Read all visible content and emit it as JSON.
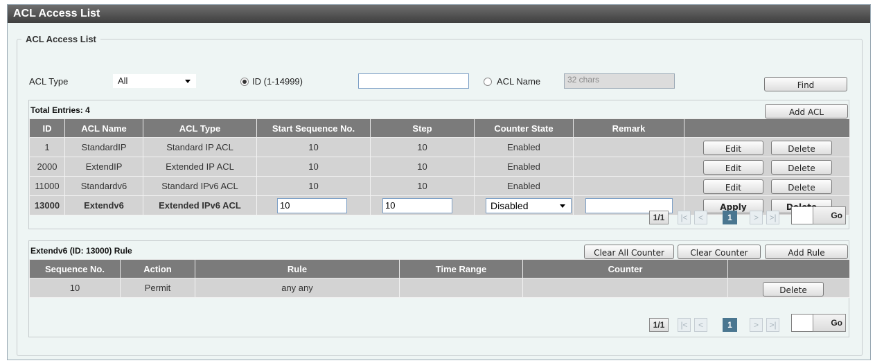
{
  "page": {
    "title": "ACL Access List"
  },
  "filter": {
    "legend": "ACL Access List",
    "acl_type_label": "ACL Type",
    "acl_type_value": "All",
    "radio_id_label": "ID (1-14999)",
    "id_value": "",
    "radio_name_label": "ACL Name",
    "name_placeholder": "32 chars",
    "find_label": "Find"
  },
  "acl_table": {
    "total_label": "Total Entries: 4",
    "add_label": "Add ACL",
    "columns": [
      "ID",
      "ACL Name",
      "ACL Type",
      "Start Sequence No.",
      "Step",
      "Counter State",
      "Remark",
      ""
    ],
    "rows": [
      {
        "id": "1",
        "name": "StandardIP",
        "type": "Standard IP ACL",
        "start": "10",
        "step": "10",
        "counter": "Enabled",
        "remark": "",
        "edit": "Edit",
        "delete": "Delete"
      },
      {
        "id": "2000",
        "name": "ExtendIP",
        "type": "Extended IP ACL",
        "start": "10",
        "step": "10",
        "counter": "Enabled",
        "remark": "",
        "edit": "Edit",
        "delete": "Delete"
      },
      {
        "id": "11000",
        "name": "Standardv6",
        "type": "Standard IPv6 ACL",
        "start": "10",
        "step": "10",
        "counter": "Enabled",
        "remark": "",
        "edit": "Edit",
        "delete": "Delete"
      }
    ],
    "editing_row": {
      "id": "13000",
      "name": "Extendv6",
      "type": "Extended IPv6 ACL",
      "start_value": "10",
      "step_value": "10",
      "counter_value": "Disabled",
      "remark_value": "",
      "apply": "Apply",
      "delete": "Delete"
    },
    "pagination": {
      "info": "1/1",
      "first": "|<",
      "prev": "<",
      "current": "1",
      "next": ">",
      "last": ">|",
      "page_input": "",
      "go": "Go"
    }
  },
  "rule_table": {
    "title": "Extendv6 (ID: 13000) Rule",
    "clear_all_label": "Clear All Counter",
    "clear_label": "Clear Counter",
    "add_rule_label": "Add Rule",
    "columns": [
      "Sequence No.",
      "Action",
      "Rule",
      "Time Range",
      "Counter",
      ""
    ],
    "rows": [
      {
        "seq": "10",
        "action": "Permit",
        "rule": "any any",
        "time_range": "",
        "counter": "",
        "delete": "Delete"
      }
    ],
    "pagination": {
      "info": "1/1",
      "first": "|<",
      "prev": "<",
      "current": "1",
      "next": ">",
      "last": ">|",
      "page_input": "",
      "go": "Go"
    }
  }
}
